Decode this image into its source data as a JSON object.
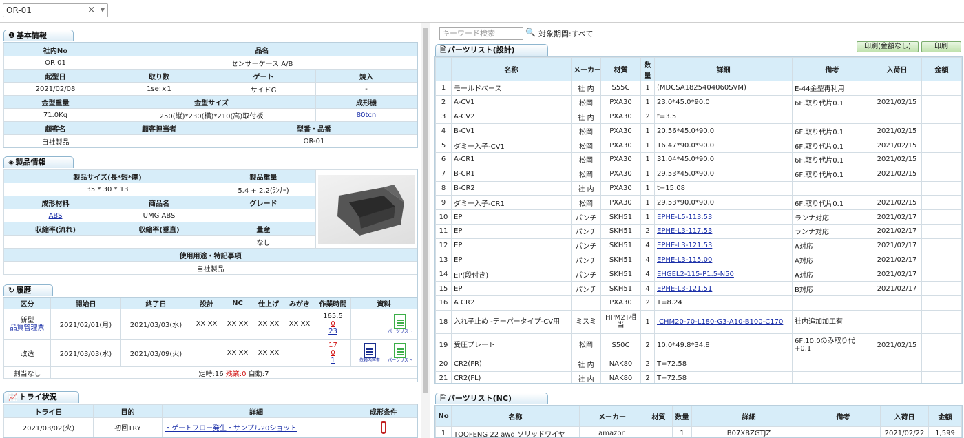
{
  "selector": {
    "value": "OR-01",
    "clear": "×",
    "arrow": "▼"
  },
  "basic": {
    "title": "基本情報",
    "h1": [
      "社内No",
      "品名"
    ],
    "r1": [
      "OR 01",
      "センサーケース A/B"
    ],
    "h2": [
      "起型日",
      "取り数",
      "ゲート",
      "焼入"
    ],
    "r2": [
      "2021/02/08",
      "1se:×1",
      "サイドG",
      "-"
    ],
    "h3": [
      "金型重量",
      "金型サイズ",
      "成形機"
    ],
    "r3": [
      "71.0Kg",
      "250(縦)*230(横)*210(高)取付板",
      "80tcn"
    ],
    "h4": [
      "顧客名",
      "顧客担当者",
      "型番・品番"
    ],
    "r4": [
      "自社製品",
      "",
      "OR-01"
    ]
  },
  "product": {
    "title": "製品情報",
    "h1": [
      "製品サイズ(長*短*厚)",
      "製品重量"
    ],
    "r1": [
      "35 * 30 * 13",
      "5.4 + 2.2(ﾗﾝﾅｰ)"
    ],
    "h2": [
      "成形材料",
      "商品名",
      "グレード"
    ],
    "r2": [
      "ABS",
      "UMG ABS",
      ""
    ],
    "h3": [
      "収縮率(流れ)",
      "収縮率(垂直)",
      "量産"
    ],
    "r3": [
      "",
      "",
      "なし"
    ],
    "h4": "使用用途・特記事項",
    "r4": "自社製品"
  },
  "history": {
    "title": "履歴",
    "headers": [
      "区分",
      "開始日",
      "終了日",
      "設計",
      "NC",
      "仕上げ",
      "みがき",
      "作業時間",
      "資料"
    ],
    "rows": [
      {
        "kubun": "新型",
        "sub": "品質管理票",
        "start": "2021/02/01(月)",
        "end": "2021/03/03(水)",
        "d": "XX XX",
        "nc": "XX XX",
        "fin": "XX XX",
        "pol": "XX XX",
        "t1": "165.5",
        "t2": "0",
        "t3": "23",
        "docs": [
          "パーツリスト"
        ]
      },
      {
        "kubun": "改造",
        "sub": "",
        "start": "2021/03/03(水)",
        "end": "2021/03/09(火)",
        "d": "",
        "nc": "XX XX",
        "fin": "XX XX",
        "pol": "",
        "t1": "17",
        "t2": "0",
        "t3": "1",
        "docs": [
          "依頼内容書",
          "パーツリスト"
        ]
      }
    ],
    "footer_left": "割当なし",
    "footer_a": "定時:16",
    "footer_b": "残業:0",
    "footer_c": "自動:7"
  },
  "tri": {
    "title": "トライ状況",
    "headers": [
      "トライ日",
      "目的",
      "詳細",
      "成形条件"
    ],
    "rows": [
      {
        "date": "2021/03/02(火)",
        "purpose": "初回TRY",
        "detail": "・ゲートフロー発生・サンプル20ショット"
      }
    ]
  },
  "search": {
    "placeholder": "キーワード検索",
    "period": "対象期間:すべて"
  },
  "buttons": {
    "print_noprice": "印刷(金額なし)",
    "print": "印刷"
  },
  "parts": {
    "title": "パーツリスト(設計)",
    "headers": [
      "",
      "名称",
      "メーカー",
      "材質",
      "数量",
      "詳細",
      "備考",
      "入荷日",
      "金額"
    ],
    "rows": [
      [
        "1",
        "モールドベース",
        "社 内",
        "S55C",
        "1",
        "(MDCSA1825404060SVM)",
        "E-44金型再利用",
        "",
        ""
      ],
      [
        "2",
        "A-CV1",
        "松岡",
        "PXA30",
        "1",
        "23.0*45.0*90.0",
        "6F,取り代片0.1",
        "2021/02/15",
        ""
      ],
      [
        "3",
        "A-CV2",
        "社 内",
        "PXA30",
        "2",
        "t=3.5",
        "",
        "",
        ""
      ],
      [
        "4",
        "B-CV1",
        "松岡",
        "PXA30",
        "1",
        "20.56*45.0*90.0",
        "6F,取り代片0.1",
        "2021/02/15",
        ""
      ],
      [
        "5",
        "ダミー入子-CV1",
        "松岡",
        "PXA30",
        "1",
        "16.47*90.0*90.0",
        "6F,取り代片0.1",
        "2021/02/15",
        ""
      ],
      [
        "6",
        "A-CR1",
        "松岡",
        "PXA30",
        "1",
        "31.04*45.0*90.0",
        "6F,取り代片0.1",
        "2021/02/15",
        ""
      ],
      [
        "7",
        "B-CR1",
        "松岡",
        "PXA30",
        "1",
        "29.53*45.0*90.0",
        "6F,取り代片0.1",
        "2021/02/15",
        ""
      ],
      [
        "8",
        "B-CR2",
        "社 内",
        "PXA30",
        "1",
        "t=15.08",
        "",
        "",
        ""
      ],
      [
        "9",
        "ダミー入子-CR1",
        "松岡",
        "PXA30",
        "1",
        "29.53*90.0*90.0",
        "6F,取り代片0.1",
        "2021/02/15",
        ""
      ],
      [
        "10",
        "EP",
        "パンチ",
        "SKH51",
        "1",
        "EPHE-L5-113.53",
        "ランナ対応",
        "2021/02/17",
        ""
      ],
      [
        "11",
        "EP",
        "パンチ",
        "SKH51",
        "2",
        "EPHE-L3-117.53",
        "ランナ対応",
        "2021/02/17",
        ""
      ],
      [
        "12",
        "EP",
        "パンチ",
        "SKH51",
        "4",
        "EPHE-L3-121.53",
        "A対応",
        "2021/02/17",
        ""
      ],
      [
        "13",
        "EP",
        "パンチ",
        "SKH51",
        "4",
        "EPHE-L3-115.00",
        "A対応",
        "2021/02/17",
        ""
      ],
      [
        "14",
        "EP(段付き)",
        "パンチ",
        "SKH51",
        "4",
        "EHGEL2-115-P1.5-N50",
        "A対応",
        "2021/02/17",
        ""
      ],
      [
        "15",
        "EP",
        "パンチ",
        "SKH51",
        "4",
        "EPHE-L3-121.51",
        "B対応",
        "2021/02/17",
        ""
      ],
      [
        "16",
        "A CR2",
        "",
        "PXA30",
        "2",
        "T=8.24",
        "",
        "",
        ""
      ],
      [
        "18",
        "入れ子止め -テーパータイプ-CV用",
        "ミスミ",
        "HPM2T相当",
        "1",
        "ICHM20-70-L180-G3-A10-B100-C170",
        "社内追加加工有",
        "",
        ""
      ],
      [
        "19",
        "受圧プレート",
        "松岡",
        "S50C",
        "2",
        "10.0*49.8*34.8",
        "6F,10.0のみ取り代+0.1",
        "2021/02/15",
        ""
      ],
      [
        "20",
        "CR2(FR)",
        "社 内",
        "NAK80",
        "2",
        "T=72.58",
        "",
        "",
        ""
      ],
      [
        "21",
        "CR2(FL)",
        "社 内",
        "NAK80",
        "2",
        "T=72.58",
        "",
        "",
        ""
      ]
    ]
  },
  "parts_nc": {
    "title": "パーツリスト(NC)",
    "headers": [
      "No",
      "名称",
      "メーカー",
      "材質",
      "数量",
      "詳細",
      "備考",
      "入荷日",
      "金額"
    ],
    "rows": [
      [
        "1",
        "TOOFENG 22 awg ソリッドワイヤ",
        "amazon",
        "",
        "1",
        "B07XBZGTJZ",
        "",
        "2021/02/22",
        "1,599"
      ]
    ]
  }
}
